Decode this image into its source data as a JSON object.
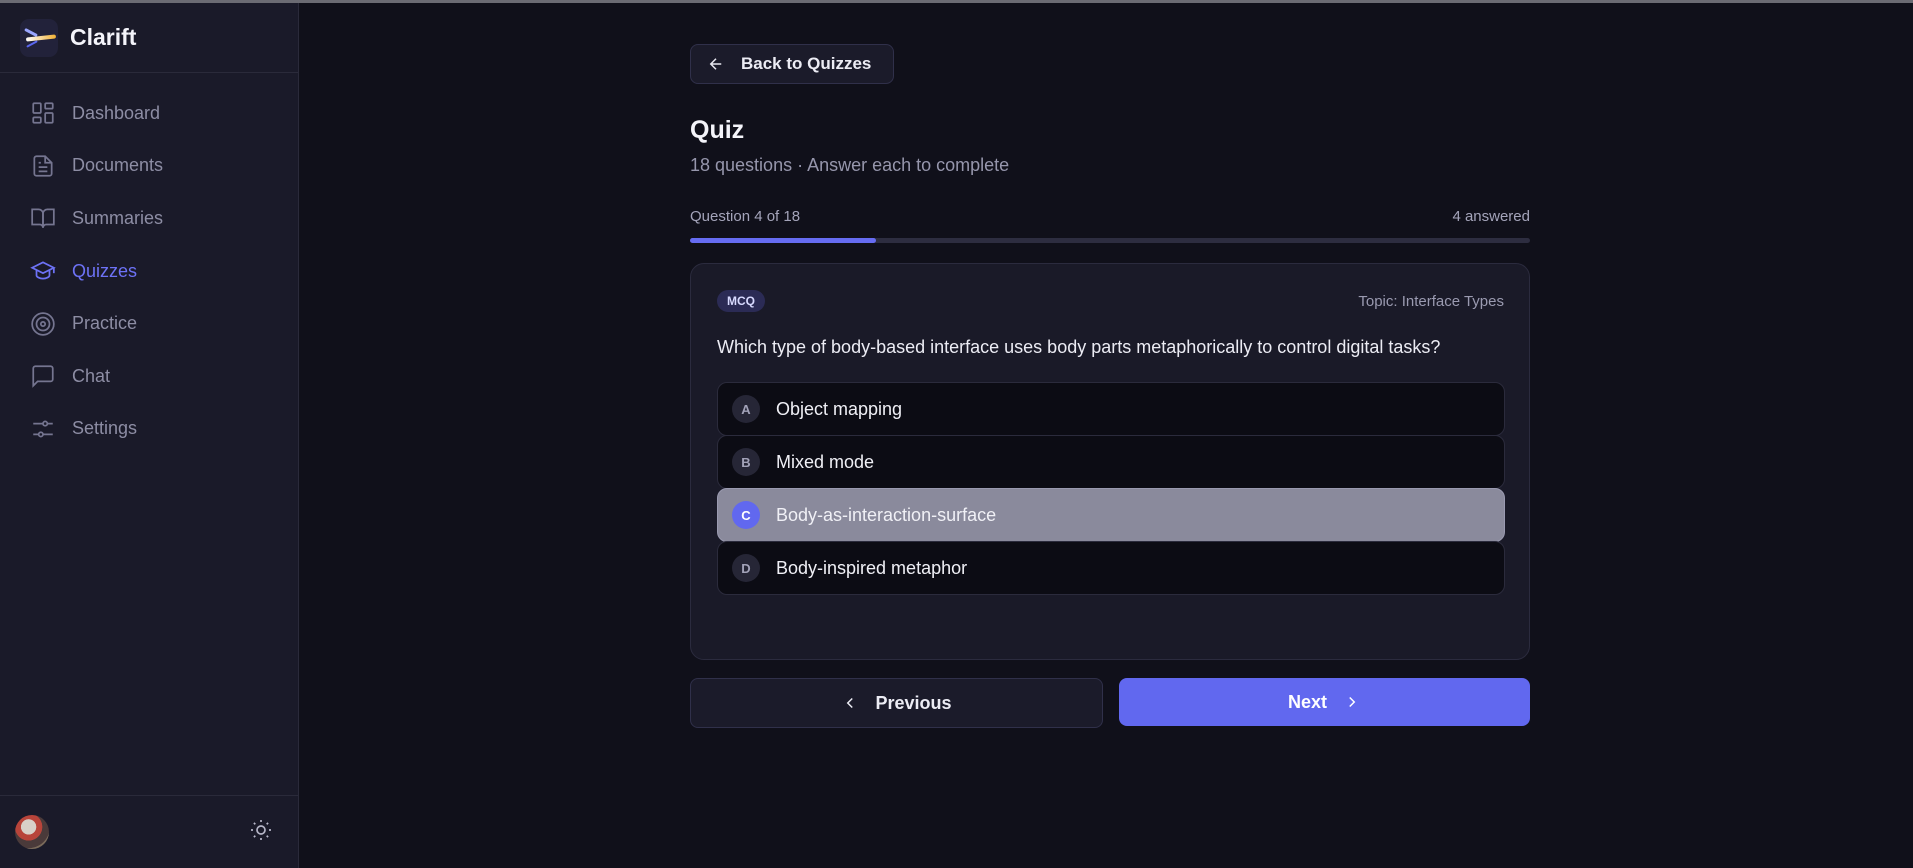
{
  "brand": {
    "name": "Clarift"
  },
  "sidebar": {
    "items": [
      {
        "label": "Dashboard",
        "icon": "dashboard-icon"
      },
      {
        "label": "Documents",
        "icon": "document-icon"
      },
      {
        "label": "Summaries",
        "icon": "book-icon"
      },
      {
        "label": "Quizzes",
        "icon": "graduation-cap-icon",
        "active": true
      },
      {
        "label": "Practice",
        "icon": "target-icon"
      },
      {
        "label": "Chat",
        "icon": "chat-icon"
      },
      {
        "label": "Settings",
        "icon": "sliders-icon"
      }
    ]
  },
  "header": {
    "back_label": "Back to Quizzes",
    "title": "Quiz",
    "subtitle": "18 questions · Answer each to complete"
  },
  "progress": {
    "label": "Question 4 of 18",
    "answered": "4 answered",
    "fraction": 0.222
  },
  "question": {
    "type_badge": "MCQ",
    "topic": "Topic: Interface Types",
    "text": "Which type of body-based interface uses body parts metaphorically to control digital tasks?",
    "options": [
      {
        "letter": "A",
        "text": "Object mapping"
      },
      {
        "letter": "B",
        "text": "Mixed mode"
      },
      {
        "letter": "C",
        "text": "Body-as-interaction-surface",
        "selected": true
      },
      {
        "letter": "D",
        "text": "Body-inspired metaphor"
      }
    ]
  },
  "nav_buttons": {
    "previous": "Previous",
    "next": "Next"
  },
  "colors": {
    "accent": "#6168ef",
    "background": "#10101a",
    "sidebar": "#1a1a29"
  }
}
